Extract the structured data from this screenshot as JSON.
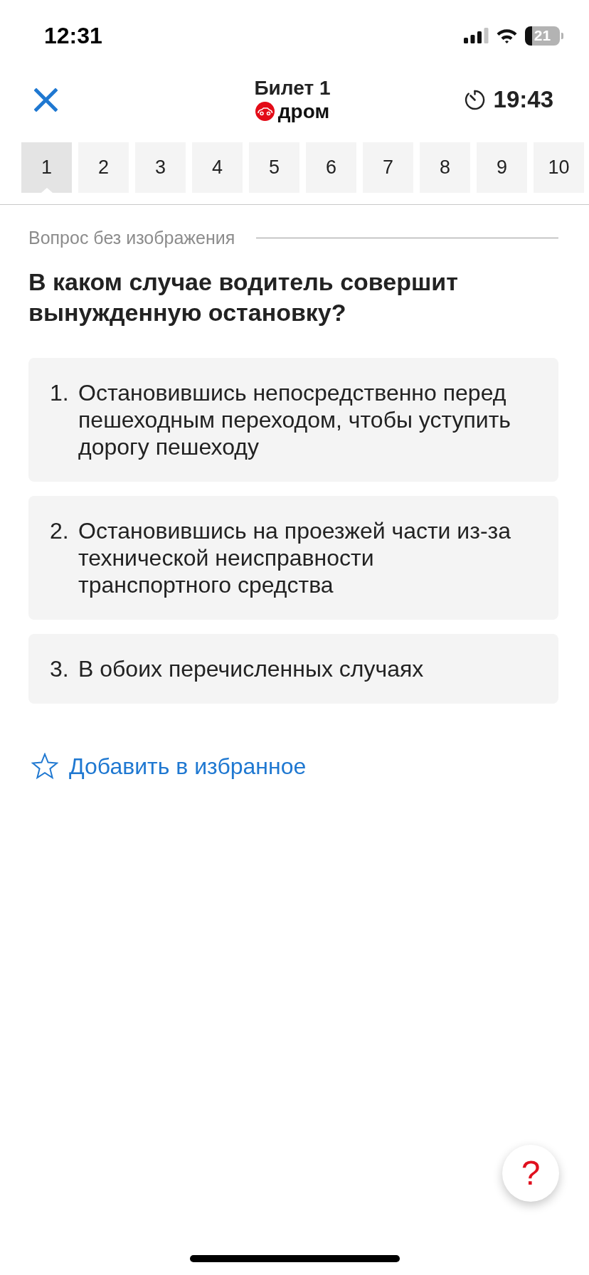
{
  "status_bar": {
    "time": "12:31",
    "battery": "21"
  },
  "header": {
    "title": "Билет 1",
    "logo": "дром",
    "timer": "19:43"
  },
  "tabs": [
    {
      "label": "1",
      "selected": true
    },
    {
      "label": "2",
      "selected": false
    },
    {
      "label": "3",
      "selected": false
    },
    {
      "label": "4",
      "selected": false
    },
    {
      "label": "5",
      "selected": false
    },
    {
      "label": "6",
      "selected": false
    },
    {
      "label": "7",
      "selected": false
    },
    {
      "label": "8",
      "selected": false
    },
    {
      "label": "9",
      "selected": false
    },
    {
      "label": "10",
      "selected": false
    }
  ],
  "question": {
    "note": "Вопрос без изображения",
    "text": "В каком случае водитель совершит вынужденную остановку?"
  },
  "answers": [
    {
      "number": "1.",
      "text": "Остановившись непосредственно перед пешеходным переходом, чтобы уступить дорогу пешеходу"
    },
    {
      "number": "2.",
      "text": "Остановившись на проезжей части из-за технической неисправности транспортного средства"
    },
    {
      "number": "3.",
      "text": "В обоих перечисленных случаях"
    }
  ],
  "favorite": {
    "label": "Добавить в избранное"
  },
  "help_button": {
    "label": "?"
  }
}
